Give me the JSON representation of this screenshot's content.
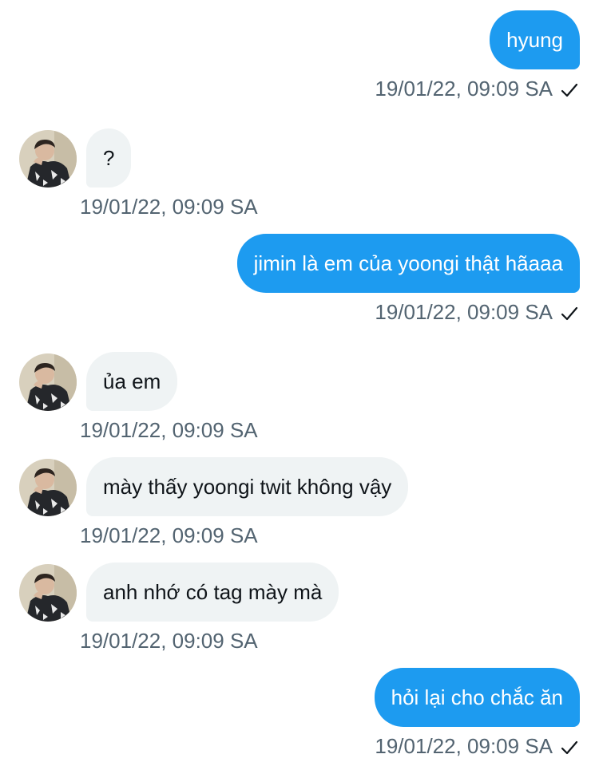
{
  "colors": {
    "outgoing_bubble": "#1d9bf0",
    "incoming_bubble": "#eff3f4",
    "timestamp": "#536471"
  },
  "icons": {
    "sent_status": "check-icon",
    "sender_avatar": "avatar"
  },
  "messages": [
    {
      "direction": "outgoing",
      "text": "hyung",
      "timestamp": "19/01/22, 09:09 SA",
      "sent_check": true
    },
    {
      "direction": "incoming",
      "text": "?",
      "timestamp": "19/01/22, 09:09 SA"
    },
    {
      "direction": "outgoing",
      "text": "jimin là em của yoongi thật hãaaa",
      "timestamp": "19/01/22, 09:09 SA",
      "sent_check": true
    },
    {
      "direction": "incoming",
      "text": "ủa em",
      "timestamp": "19/01/22, 09:09 SA"
    },
    {
      "direction": "incoming",
      "text": "mày thấy yoongi twit không vậy",
      "timestamp": "19/01/22, 09:09 SA"
    },
    {
      "direction": "incoming",
      "text": "anh nhớ có tag mày mà",
      "timestamp": "19/01/22, 09:09 SA"
    },
    {
      "direction": "outgoing",
      "text": "hỏi lại cho chắc ăn",
      "timestamp": "19/01/22, 09:09 SA",
      "sent_check": true
    }
  ]
}
